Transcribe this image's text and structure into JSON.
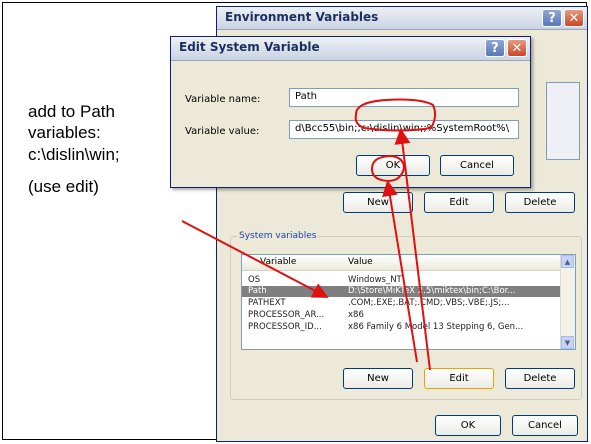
{
  "annotation": {
    "line1": "add to Path",
    "line2": "variables:",
    "line3": "c:\\dislin\\win;",
    "line4": "(use edit)"
  },
  "env_window": {
    "title": "Environment Variables",
    "help_glyph": "?",
    "close_glyph": "✕",
    "user_buttons": {
      "new": "New",
      "edit": "Edit",
      "delete": "Delete"
    },
    "system_group_label": "System variables",
    "columns": {
      "variable": "Variable",
      "value": "Value"
    },
    "rows": [
      {
        "variable": "OS",
        "value": "Windows_NT"
      },
      {
        "variable": "Path",
        "value": "D:\\Store\\MiKTeX 2.5\\miktex\\bin;C:\\Bor..."
      },
      {
        "variable": "PATHEXT",
        "value": ".COM;.EXE;.BAT;.CMD;.VBS;.VBE;.JS;..."
      },
      {
        "variable": "PROCESSOR_AR...",
        "value": "x86"
      },
      {
        "variable": "PROCESSOR_ID...",
        "value": "x86 Family 6 Model 13 Stepping 6, Gen..."
      }
    ],
    "selected_row": "Path",
    "system_buttons": {
      "new": "New",
      "edit": "Edit",
      "delete": "Delete"
    },
    "ok": "OK",
    "cancel": "Cancel"
  },
  "edit_dialog": {
    "title": "Edit System Variable",
    "help_glyph": "?",
    "close_glyph": "✕",
    "name_label": "Variable name:",
    "name_value": "Path",
    "value_label": "Variable value:",
    "value_value": "d\\Bcc55\\bin;;c:\\dislin\\win;;%SystemRoot%\\",
    "ok": "OK",
    "cancel": "Cancel"
  },
  "colors": {
    "arrow": "#e01010",
    "highlight": "#e01010"
  }
}
